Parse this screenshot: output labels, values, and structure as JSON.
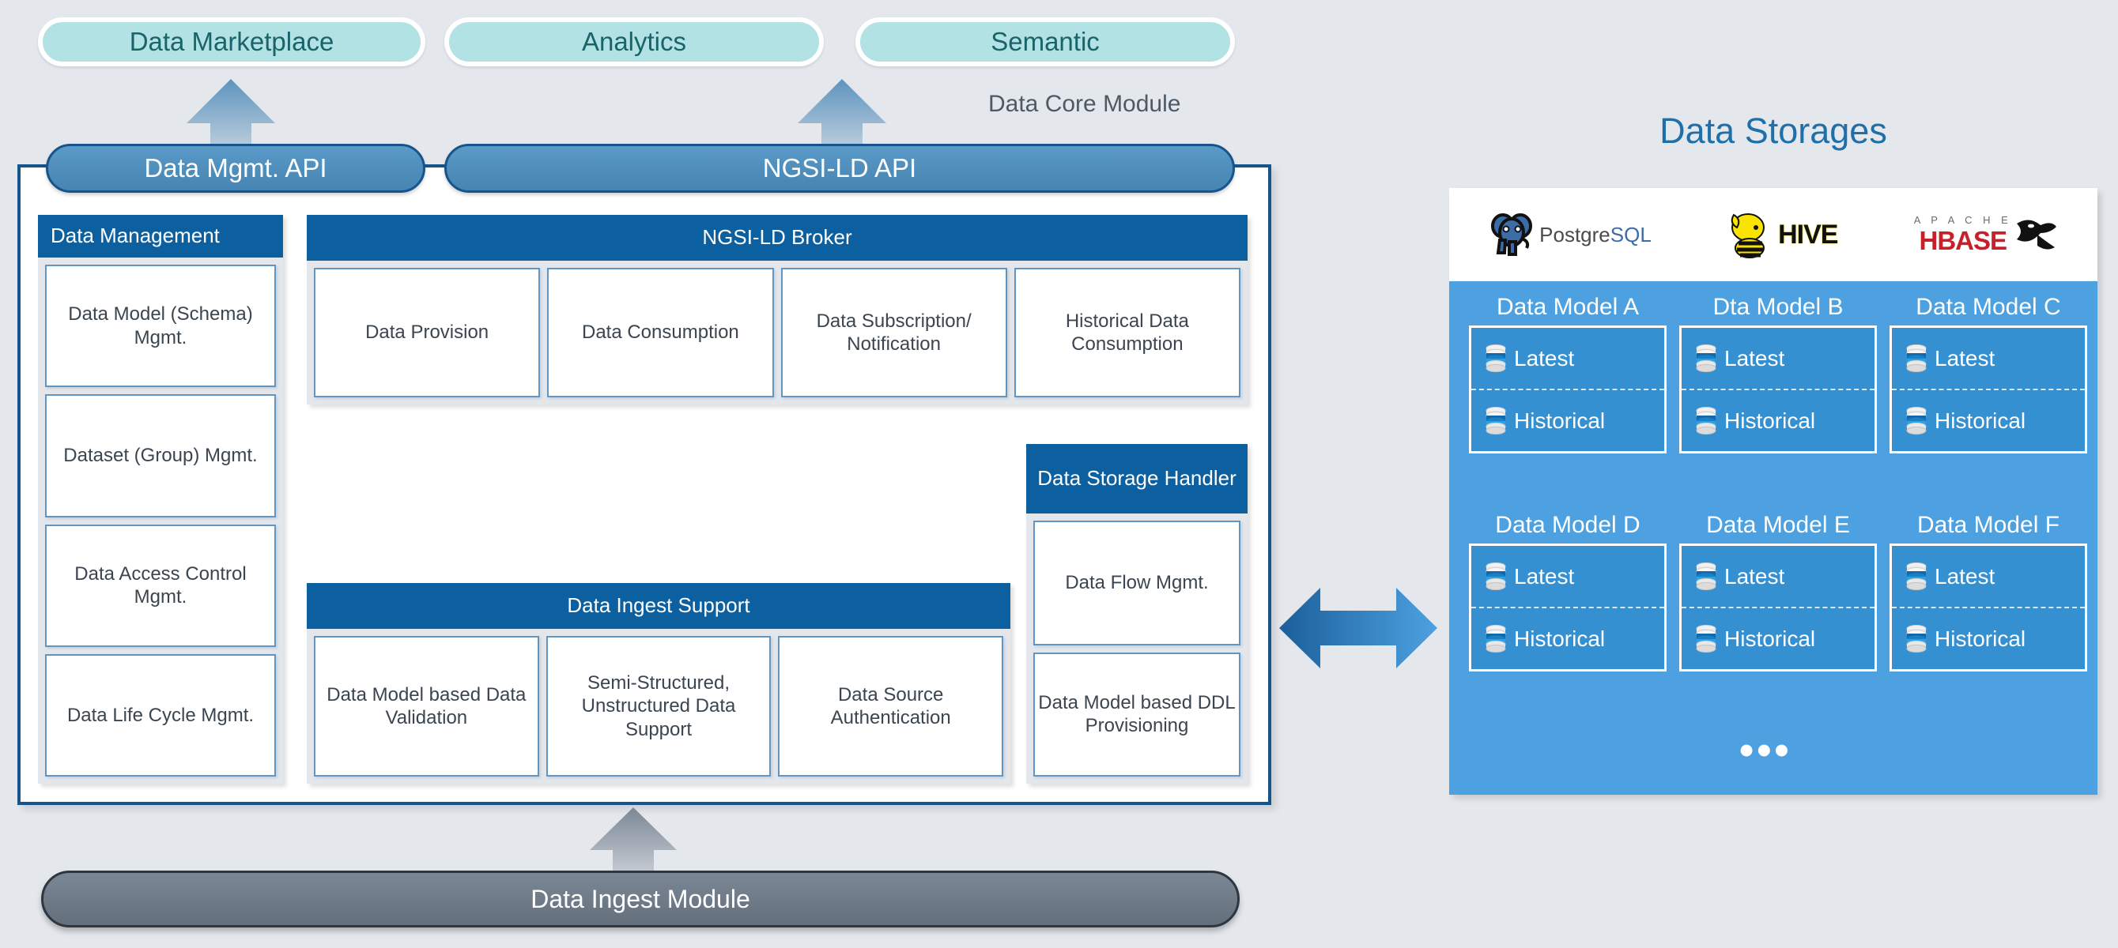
{
  "consumers": [
    {
      "label": "Data Marketplace"
    },
    {
      "label": "Analytics"
    },
    {
      "label": "Semantic"
    }
  ],
  "core": {
    "module_label": "Data Core Module",
    "apis": [
      {
        "label": "Data Mgmt. API"
      },
      {
        "label": "NGSI-LD API"
      }
    ],
    "data_management": {
      "title": "Data Management",
      "items": [
        "Data Model (Schema) Mgmt.",
        "Dataset (Group) Mgmt.",
        "Data Access Control Mgmt.",
        "Data Life Cycle Mgmt."
      ]
    },
    "broker": {
      "title": "NGSI-LD Broker",
      "items": [
        "Data Provision",
        "Data Consumption",
        "Data Subscription/ Notification",
        "Historical Data Consumption"
      ]
    },
    "ingest_support": {
      "title": "Data Ingest Support",
      "items": [
        "Data Model based Data Validation",
        "Semi-Structured, Unstructured Data Support",
        "Data Source Authentication"
      ]
    },
    "storage_handler": {
      "title": "Data Storage Handler",
      "items": [
        "Data Flow Mgmt.",
        "Data Model based DDL Provisioning"
      ]
    }
  },
  "ingest_module": {
    "label": "Data Ingest Module"
  },
  "storages": {
    "title": "Data Storages",
    "logos": [
      {
        "name": "postgresql-logo",
        "text": "PostgreSQL"
      },
      {
        "name": "hive-logo",
        "text": "HIVE"
      },
      {
        "name": "hbase-logo",
        "text": "HBASE",
        "sup": "A P A C H E"
      }
    ],
    "tier_labels": {
      "latest": "Latest",
      "historical": "Historical"
    },
    "models": [
      {
        "label": "Data Model A"
      },
      {
        "label": "Dta Model B"
      },
      {
        "label": "Data Model C"
      },
      {
        "label": "Data Model D"
      },
      {
        "label": "Data Model E"
      },
      {
        "label": "Data Model F"
      }
    ],
    "ellipsis": "•••"
  },
  "colors": {
    "background": "#e4e7ec",
    "consumer_fill": "#b3e2e4",
    "consumer_text": "#19636b",
    "api_fill": "#4e8cb9",
    "frame_border": "#17548c",
    "group_header": "#0c609f",
    "group_body": "#e3e7ec",
    "tile_border": "#5f96c4",
    "tile_text": "#3b4550",
    "storage_panel": "#4da1e0",
    "storage_card": "#3590d2",
    "storages_title": "#1f6fa8",
    "module_bar": "#6e7a87",
    "arrow_blue": "#2b7cba"
  },
  "icons": {
    "db_cylinder": "database-cylinder-icon",
    "up_arrow": "up-arrow-icon",
    "exchange_arrow": "bidirectional-arrow-icon"
  }
}
